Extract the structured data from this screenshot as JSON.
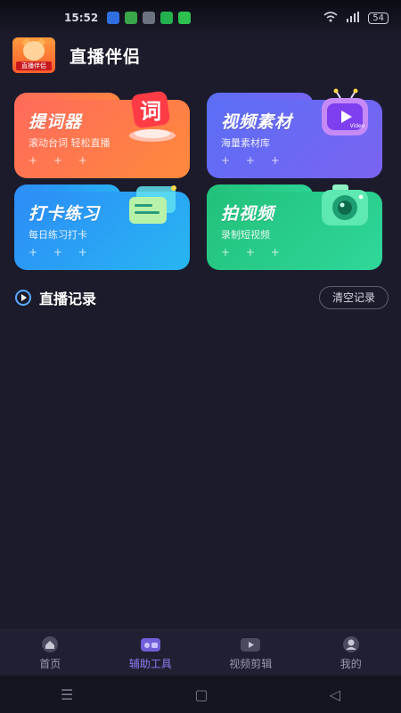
{
  "status_bar": {
    "time": "15:52",
    "battery": "54"
  },
  "app": {
    "title": "直播伴侣",
    "logo_text": "直播伴侣"
  },
  "cards": [
    {
      "title": "提词器",
      "subtitle": "滚动台词 轻松直播",
      "art_text": "词",
      "plus": "+ + +"
    },
    {
      "title": "视频素材",
      "subtitle": "海量素材库",
      "art_text": "Video",
      "plus": "+ + +"
    },
    {
      "title": "打卡练习",
      "subtitle": "每日练习打卡",
      "plus": "+ + +"
    },
    {
      "title": "拍视频",
      "subtitle": "录制短视频",
      "plus": "+ + +"
    }
  ],
  "records": {
    "title": "直播记录",
    "clear_label": "清空记录"
  },
  "bottom_nav": [
    {
      "label": "首页",
      "icon": "home-icon"
    },
    {
      "label": "辅助工具",
      "icon": "toolbox-icon",
      "active": true
    },
    {
      "label": "视频剪辑",
      "icon": "video-edit-icon"
    },
    {
      "label": "我的",
      "icon": "profile-icon"
    }
  ],
  "system_nav": {
    "menu": "☰",
    "home": "▢",
    "back": "◁"
  },
  "colors": {
    "background": "#1b1b2b",
    "active_nav": "#8a7cf5"
  }
}
